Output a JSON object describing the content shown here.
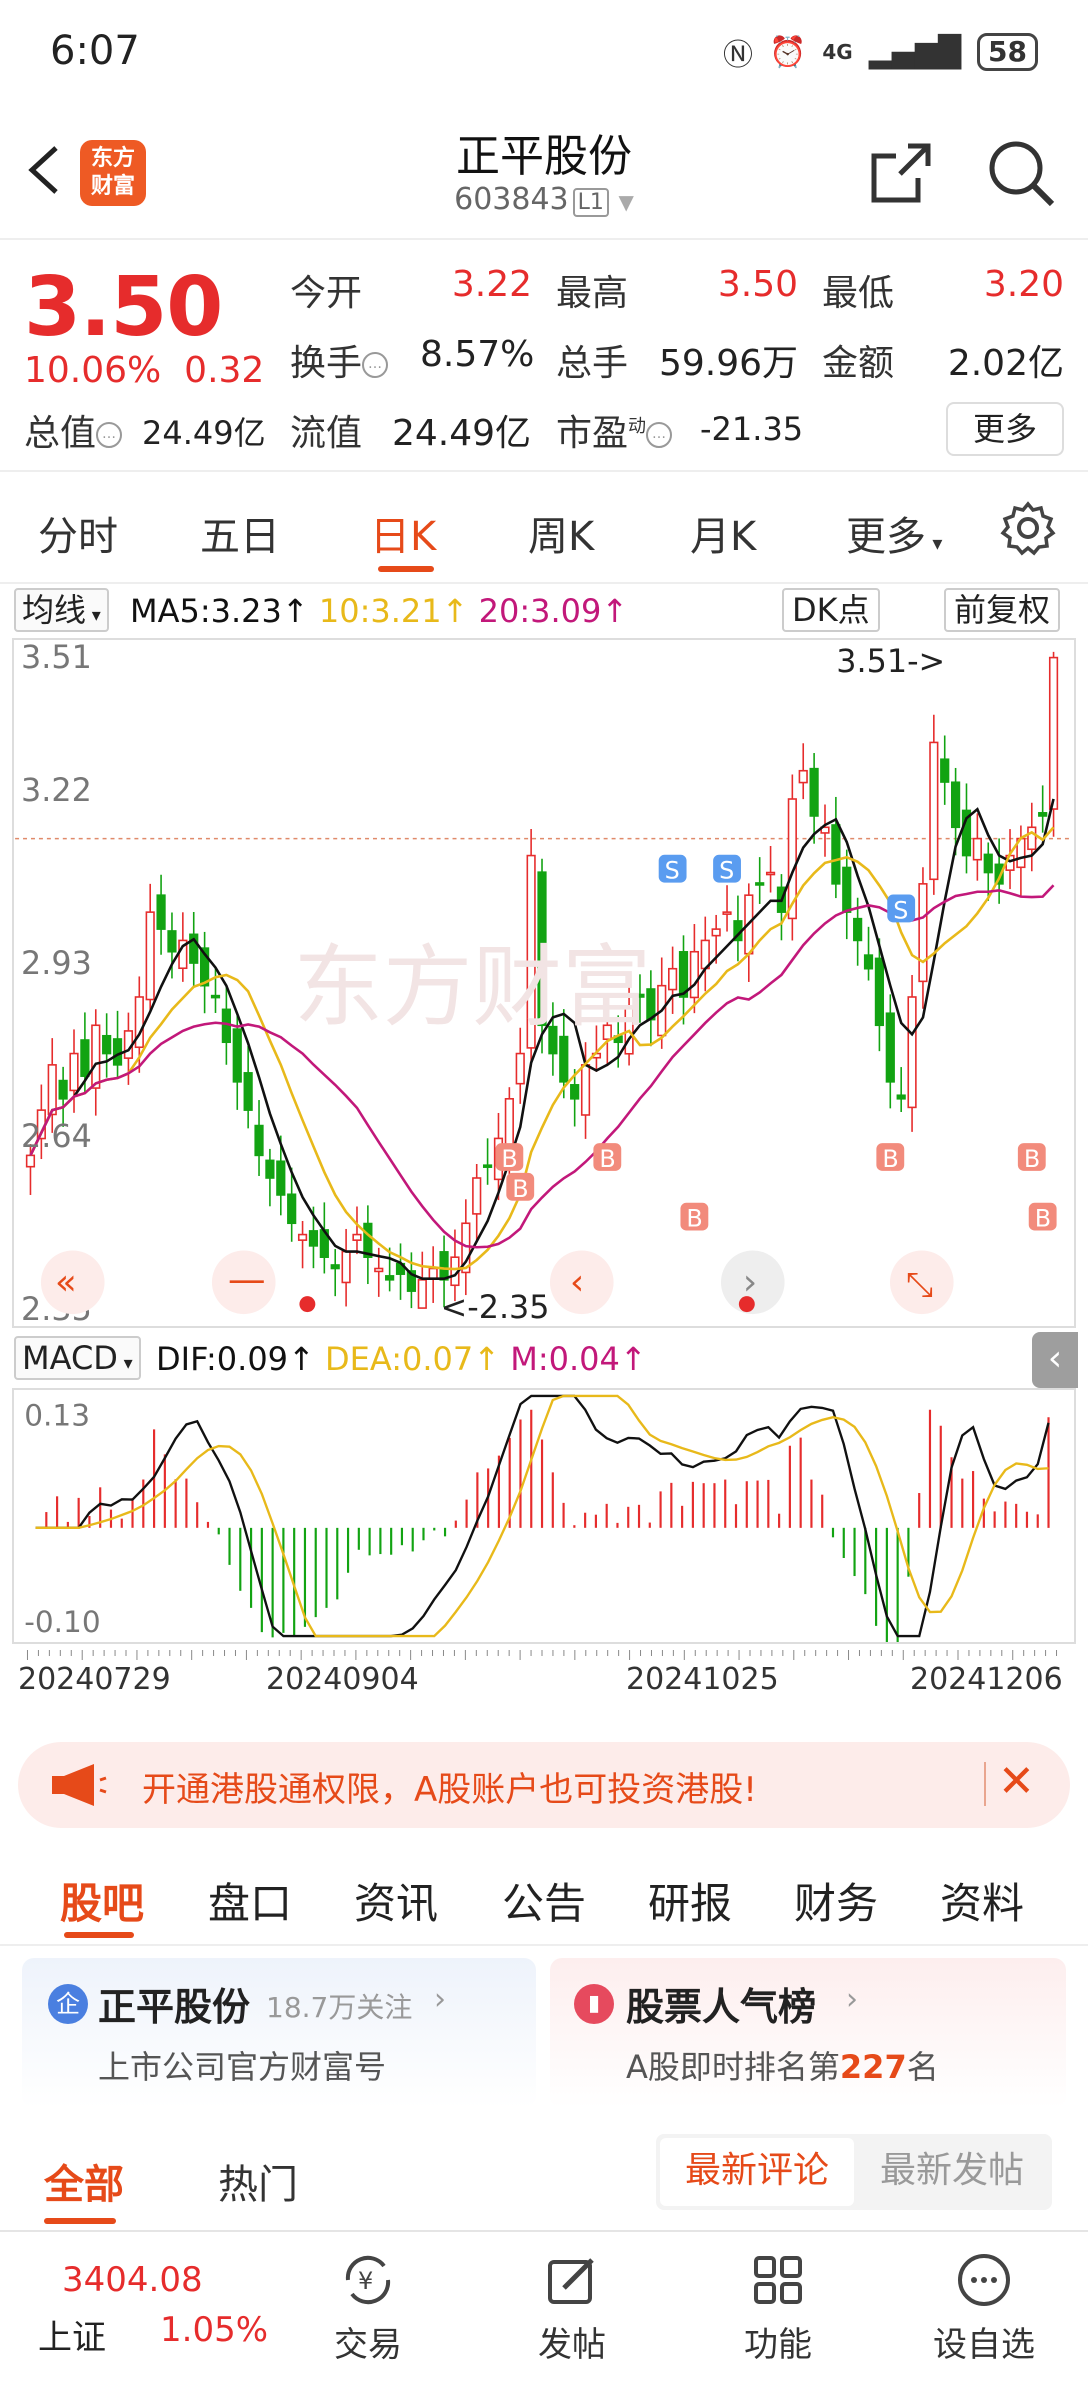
{
  "status": {
    "time": "6:07",
    "battery": "58",
    "network": "4G"
  },
  "header": {
    "logo": "东方\n财富",
    "name": "正平股份",
    "code": "603843",
    "badge": "L1"
  },
  "quote": {
    "price": "3.50",
    "pct": "10.06%",
    "chg": "0.32",
    "open_label": "今开",
    "open": "3.22",
    "high_label": "最高",
    "high": "3.50",
    "low_label": "最低",
    "low": "3.20",
    "turnover_label": "换手",
    "turnover": "8.57%",
    "volume_label": "总手",
    "volume": "59.96万",
    "amount_label": "金额",
    "amount": "2.02亿",
    "mktcap_label": "总值",
    "mktcap": "24.49亿",
    "float_label": "流值",
    "float": "24.49亿",
    "pe_label": "市盈",
    "pe_sup": "动",
    "pe": "-21.35",
    "more": "更多"
  },
  "period_tabs": [
    "分时",
    "五日",
    "日K",
    "周K",
    "月K",
    "更多"
  ],
  "ma_bar": {
    "select": "均线",
    "ma5": "MA5:3.23↑",
    "ma10": "10:3.21↑",
    "ma20": "20:3.09↑",
    "dk": "DK点",
    "fq": "前复权"
  },
  "colors": {
    "up": "#e62c2c",
    "down": "#12a312",
    "ma5": "#111111",
    "ma10": "#e8b91a",
    "ma20": "#c2187a",
    "accent": "#e64a19"
  },
  "kchart": {
    "y_labels": [
      "3.51",
      "3.22",
      "2.93",
      "2.64",
      "2.35"
    ],
    "high_note": "3.51->",
    "low_note": "<-2.35"
  },
  "macd_bar": {
    "select": "MACD",
    "dif": "DIF:0.09↑",
    "dea": "DEA:0.07↑",
    "m": "M:0.04↑"
  },
  "macdchart": {
    "y_labels": [
      "0.13",
      "-0.10"
    ]
  },
  "dates": [
    "20240729",
    "20240904",
    "20241025",
    "20241206"
  ],
  "banner": {
    "text": "开通港股通权限，A股账户也可投资港股!"
  },
  "section_tabs": [
    "股吧",
    "盘口",
    "资讯",
    "公告",
    "研报",
    "财务",
    "资料"
  ],
  "card_left": {
    "title": "正平股份",
    "followers": "18.7万关注",
    "sub": "上市公司官方财富号"
  },
  "card_right": {
    "title": "股票人气榜",
    "sub_prefix": "A股即时排名第",
    "rank": "227",
    "sub_suffix": "名"
  },
  "feed_tabs": [
    "全部",
    "热门"
  ],
  "sort": {
    "active": "最新评论",
    "other": "最新发帖"
  },
  "bottom_nav": {
    "index_value": "3404.08",
    "index_name": "上证",
    "index_pct": "1.05%",
    "trade": "交易",
    "post": "发帖",
    "func": "功能",
    "watch": "设自选"
  }
}
